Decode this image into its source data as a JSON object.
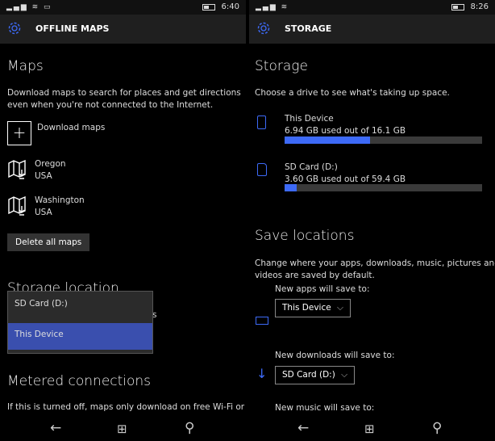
{
  "left": {
    "status": {
      "time": "6:40"
    },
    "header": {
      "title": "OFFLINE MAPS",
      "icon": "gear-icon"
    },
    "maps_title": "Maps",
    "maps_desc_1": "Download maps to search for places and get directions",
    "maps_desc_2": "even when you're not connected to the Internet.",
    "download_label": "Download maps",
    "maps": [
      {
        "name": "Oregon",
        "region": "USA"
      },
      {
        "name": "Washington",
        "region": "USA"
      }
    ],
    "delete_label": "Delete all maps",
    "storage_title": "Storage location",
    "storage_hidden_tail": "s",
    "popup_options": [
      "SD Card (D:)",
      "This Device"
    ],
    "popup_selected": "This Device",
    "metered_title": "Metered connections",
    "metered_desc": "If this is turned off, maps only download on free Wi-Fi or"
  },
  "right": {
    "status": {
      "time": "8:26"
    },
    "header": {
      "title": "STORAGE",
      "icon": "gear-icon"
    },
    "storage_title": "Storage",
    "storage_desc": "Choose a drive to see what's taking up space.",
    "drives": [
      {
        "name": "This Device",
        "usage": "6.94 GB used out of 16.1 GB",
        "used_fraction": 0.431,
        "icon": "phone-icon"
      },
      {
        "name": "SD Card (D:)",
        "usage": "3.60 GB used out of 59.4 GB",
        "used_fraction": 0.061,
        "icon": "sd-card-icon"
      }
    ],
    "save_title": "Save locations",
    "save_desc_1": "Change where your apps, downloads, music, pictures and",
    "save_desc_2": "videos are saved by default.",
    "apps_label": "New apps will save to:",
    "apps_value": "This Device",
    "downloads_label": "New downloads will save to:",
    "downloads_value": "SD Card (D:)",
    "music_label": "New music will save to:"
  },
  "colors": {
    "accent": "#3d6af7",
    "selected": "#3a4fae"
  }
}
